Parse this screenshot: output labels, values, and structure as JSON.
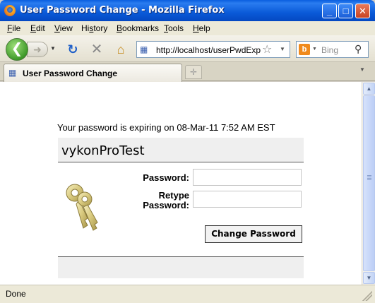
{
  "window": {
    "title": "User Password Change - Mozilla Firefox",
    "controls": {
      "minimize": "_",
      "maximize": "□",
      "close": "✕"
    }
  },
  "menu": [
    {
      "pre": "",
      "ul": "F",
      "post": "ile"
    },
    {
      "pre": "",
      "ul": "E",
      "post": "dit"
    },
    {
      "pre": "",
      "ul": "V",
      "post": "iew"
    },
    {
      "pre": "Hi",
      "ul": "s",
      "post": "tory"
    },
    {
      "pre": "",
      "ul": "B",
      "post": "ookmarks"
    },
    {
      "pre": "",
      "ul": "T",
      "post": "ools"
    },
    {
      "pre": "",
      "ul": "H",
      "post": "elp"
    }
  ],
  "toolbar": {
    "url": "http://localhost/userPwdExp",
    "search_placeholder": "Bing",
    "icons": [
      "back-arrow-icon",
      "forward-arrow-icon",
      "reload-icon",
      "stop-icon",
      "home-icon",
      "bookmark-star-icon",
      "search-icon"
    ]
  },
  "tabs": [
    {
      "label": "User Password Change"
    }
  ],
  "page": {
    "expiry_message": "Your password is expiring on 08-Mar-11 7:52 AM EST",
    "username": "vykonProTest",
    "password_label": "Password:",
    "retype_label_line1": "Retype",
    "retype_label_line2": "Password:",
    "password_value": "",
    "retype_value": "",
    "submit_label": "Change Password",
    "image_icon": "keys-icon"
  },
  "status": {
    "text": "Done"
  },
  "colors": {
    "titlebar": "#0a5ad8",
    "header_band": "#efefef",
    "content_bg": "#ffffff"
  }
}
